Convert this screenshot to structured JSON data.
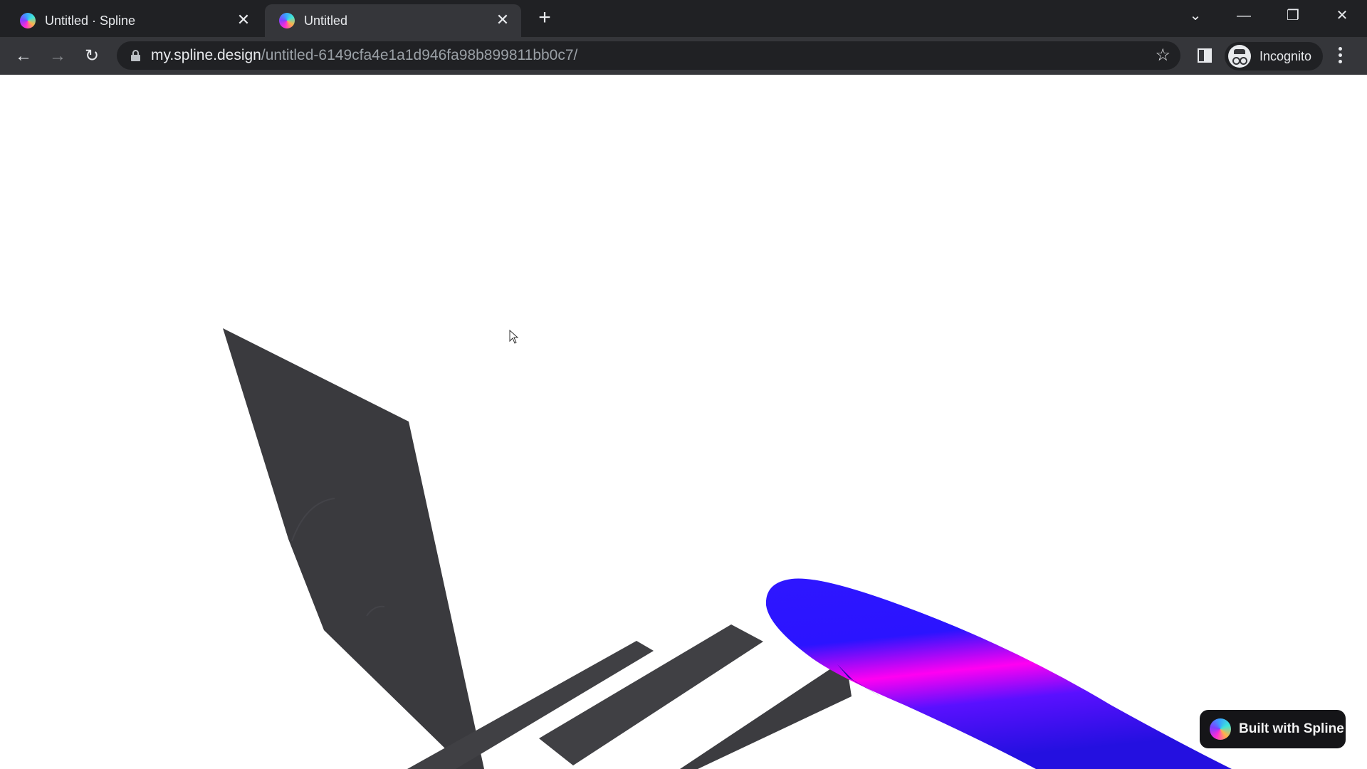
{
  "browser": {
    "tabs": [
      {
        "title": "Untitled · Spline",
        "active": false,
        "favicon": "spline-logo-icon"
      },
      {
        "title": "Untitled",
        "active": true,
        "favicon": "spline-logo-icon"
      }
    ],
    "new_tab_icon": "+",
    "window_controls": {
      "tab_search": "⌄",
      "minimize": "—",
      "restore": "❐",
      "close": "✕"
    },
    "nav": {
      "back": "←",
      "forward": "→",
      "reload": "↻"
    },
    "address": {
      "host": "my.spline.design",
      "path": "/untitled-6149cfa4e1a1d946fa98b899811bb0c7/"
    },
    "bookmark_icon": "☆",
    "profile_label": "Incognito",
    "tab_close_icon": "✕"
  },
  "scene": {
    "objects": [
      {
        "name": "dark-kite-plane",
        "color": "#3a3a3e"
      },
      {
        "name": "dark-strip-1",
        "color": "#404044"
      },
      {
        "name": "dark-strip-2",
        "color": "#404044"
      },
      {
        "name": "dark-strip-3",
        "color": "#3c3c40"
      },
      {
        "name": "blue-ellipsoid",
        "colors": [
          "#2b14ff",
          "#ff00f0",
          "#1c0ea8"
        ]
      }
    ]
  },
  "badge": {
    "label": "Built with Spline"
  }
}
